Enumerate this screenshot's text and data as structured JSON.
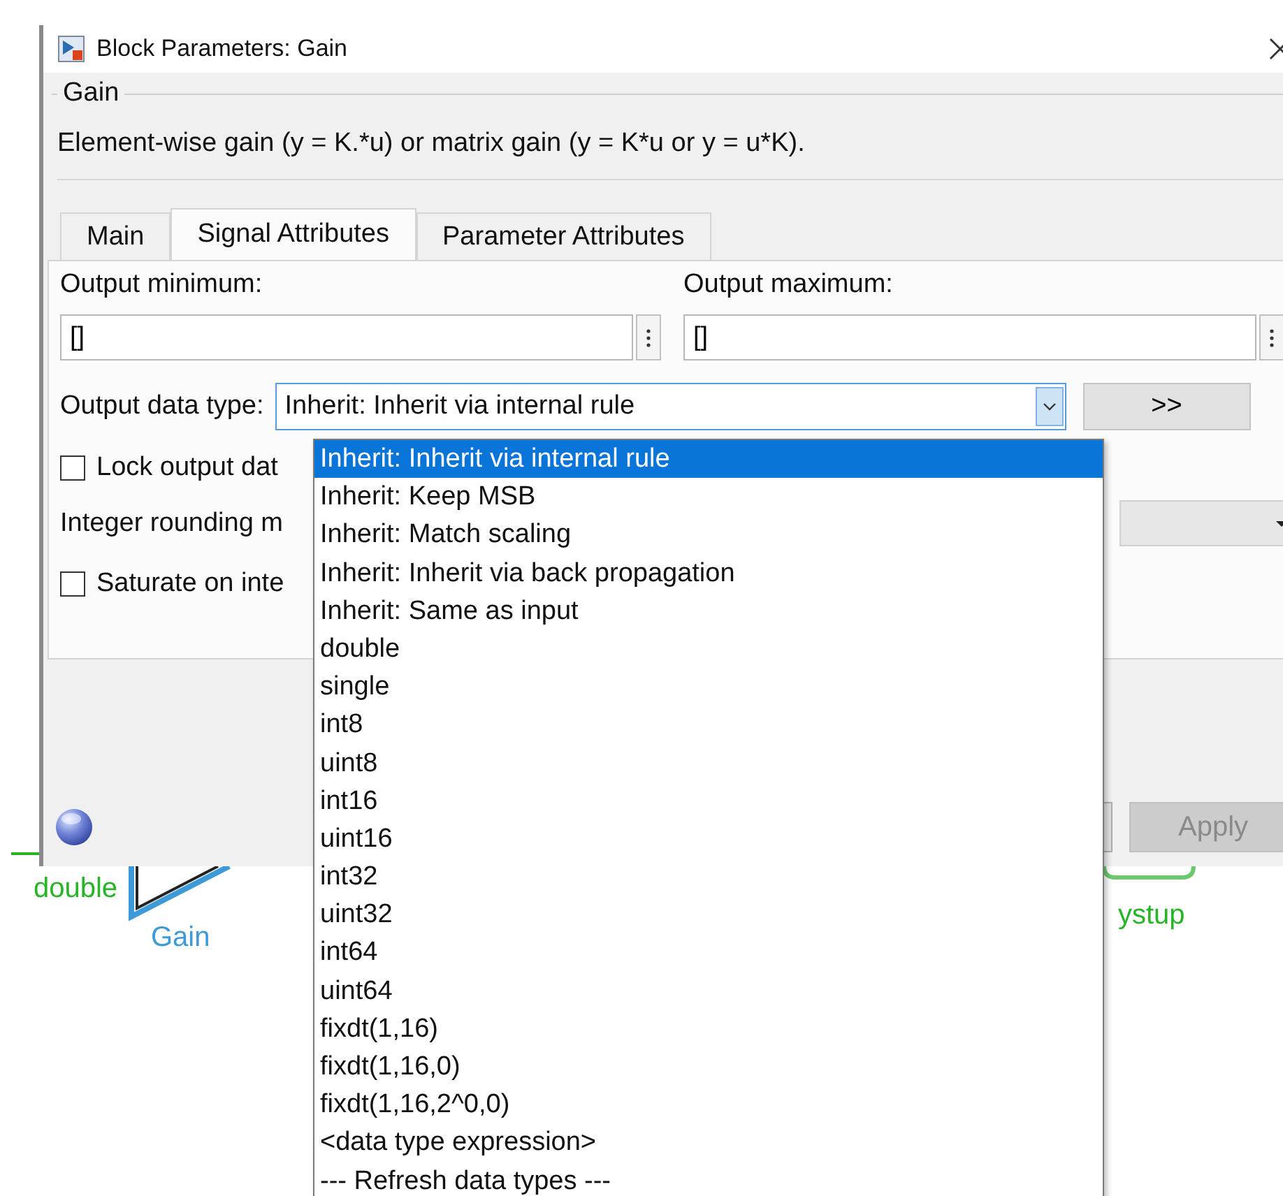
{
  "window": {
    "title": "Block Parameters: Gain"
  },
  "group": {
    "title": "Gain",
    "description": "Element-wise gain (y = K.*u) or matrix gain (y = K*u or y = u*K)."
  },
  "tabs": [
    {
      "label": "Main",
      "selected": false
    },
    {
      "label": "Signal Attributes",
      "selected": true
    },
    {
      "label": "Parameter Attributes",
      "selected": false
    }
  ],
  "fields": [
    {
      "label": "Output minimum:",
      "value": "[]"
    },
    {
      "label": "Output maximum:",
      "value": "[]"
    }
  ],
  "data_type": {
    "label": "Output data type:",
    "value": "Inherit: Inherit via internal rule",
    "expanded": true,
    "assistant_button": ">>",
    "options": [
      {
        "label": "Inherit: Inherit via internal rule",
        "selected": true
      },
      {
        "label": "Inherit: Keep MSB",
        "selected": false
      },
      {
        "label": "Inherit: Match scaling",
        "selected": false
      },
      {
        "label": "Inherit: Inherit via back propagation",
        "selected": false
      },
      {
        "label": "Inherit: Same as input",
        "selected": false
      },
      {
        "label": "double",
        "selected": false
      },
      {
        "label": "single",
        "selected": false
      },
      {
        "label": "int8",
        "selected": false
      },
      {
        "label": "uint8",
        "selected": false
      },
      {
        "label": "int16",
        "selected": false
      },
      {
        "label": "uint16",
        "selected": false
      },
      {
        "label": "int32",
        "selected": false
      },
      {
        "label": "uint32",
        "selected": false
      },
      {
        "label": "int64",
        "selected": false
      },
      {
        "label": "uint64",
        "selected": false
      },
      {
        "label": "fixdt(1,16)",
        "selected": false
      },
      {
        "label": "fixdt(1,16,0)",
        "selected": false
      },
      {
        "label": "fixdt(1,16,2^0,0)",
        "selected": false
      },
      {
        "label": "<data type expression>",
        "selected": false
      },
      {
        "label": "--- Refresh data types ---",
        "selected": false
      }
    ]
  },
  "rows": [
    {
      "kind": "checkbox",
      "label": "Lock output dat",
      "checked": false
    },
    {
      "kind": "select",
      "label": "Integer rounding m"
    },
    {
      "kind": "checkbox",
      "label": "Saturate on inte",
      "checked": false
    }
  ],
  "buttons": [
    {
      "label": "Apply",
      "disabled": true
    }
  ],
  "canvas": {
    "labels": [
      {
        "text": "double",
        "kind": "signal"
      },
      {
        "text": "Gain",
        "kind": "block"
      },
      {
        "text": "ystup",
        "kind": "signal"
      }
    ]
  }
}
